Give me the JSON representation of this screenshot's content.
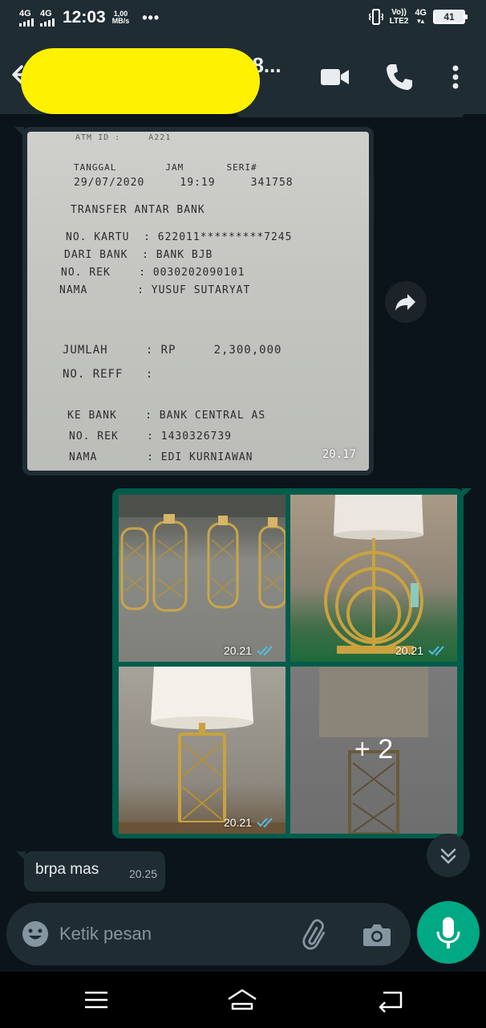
{
  "status_bar": {
    "sim1_network": "4G",
    "sim2_network": "4G",
    "time": "12:03",
    "speed_value": "1,00",
    "speed_unit": "MB/s",
    "more": "•••",
    "volte_line1": "Vo))",
    "volte_line2": "LTE2",
    "data_network": "4G",
    "battery_level": "41"
  },
  "app_bar": {
    "contact_name_visible": "68...",
    "icons": [
      "back-arrow-icon",
      "video-call-icon",
      "phone-icon",
      "more-vert-icon"
    ]
  },
  "chat": {
    "receipt_message": {
      "time": "20.17",
      "receipt_lines": [
        "ATM ID :     A221",
        "TANGGAL        JAM       SERI#",
        "29/07/2020     19:19     341758",
        "TRANSFER ANTAR BANK",
        "NO. KARTU  : 622011*********7245",
        "DARI BANK  : BANK BJB",
        "NO. REK    : 0030202090101",
        "NAMA       : YUSUF SUTARYAT",
        "JUMLAH     : RP     2,300,000",
        "NO. REFF   :",
        "KE BANK    : BANK CENTRAL AS",
        "NO. REK    : 1430326739",
        "NAMA       : EDI KURNIAWAN"
      ]
    },
    "photo_grid": {
      "tiles": [
        {
          "time": "20.21",
          "status": "read"
        },
        {
          "time": "20.21",
          "status": "read"
        },
        {
          "time": "20.21",
          "status": "read"
        },
        {
          "more_count": "+ 2"
        }
      ]
    },
    "text_message": {
      "text": "brpa mas",
      "time": "20.25"
    }
  },
  "composer": {
    "placeholder": "Ketik pesan"
  },
  "colors": {
    "app_bar": "#1f2c34",
    "chat_bg": "#0b141a",
    "outgoing_bubble": "#005c4b",
    "incoming_bubble": "#1f2c34",
    "accent": "#00a884",
    "read_ticks": "#53bdeb",
    "redaction": "#fff200"
  }
}
